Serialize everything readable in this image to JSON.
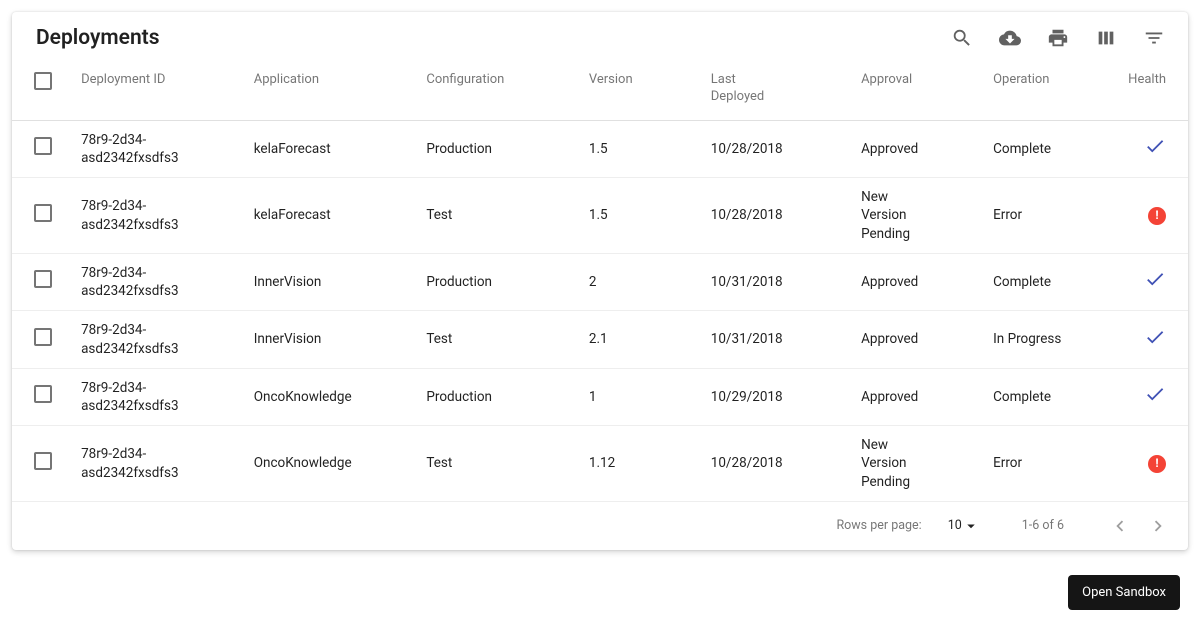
{
  "title": "Deployments",
  "columns": {
    "deployment_id": "Deployment ID",
    "application": "Application",
    "configuration": "Configuration",
    "version": "Version",
    "last_deployed": "Last Deployed",
    "approval": "Approval",
    "operation": "Operation",
    "health": "Health"
  },
  "rows": [
    {
      "deployment_id": "78r9-2d34-asd2342fxsdfs3",
      "application": "kelaForecast",
      "configuration": "Production",
      "version": "1.5",
      "last_deployed": "10/28/2018",
      "approval": "Approved",
      "operation": "Complete",
      "health": "ok"
    },
    {
      "deployment_id": "78r9-2d34-asd2342fxsdfs3",
      "application": "kelaForecast",
      "configuration": "Test",
      "version": "1.5",
      "last_deployed": "10/28/2018",
      "approval": "New Version Pending",
      "operation": "Error",
      "health": "error"
    },
    {
      "deployment_id": "78r9-2d34-asd2342fxsdfs3",
      "application": "InnerVision",
      "configuration": "Production",
      "version": "2",
      "last_deployed": "10/31/2018",
      "approval": "Approved",
      "operation": "Complete",
      "health": "ok"
    },
    {
      "deployment_id": "78r9-2d34-asd2342fxsdfs3",
      "application": "InnerVision",
      "configuration": "Test",
      "version": "2.1",
      "last_deployed": "10/31/2018",
      "approval": "Approved",
      "operation": "In Progress",
      "health": "ok"
    },
    {
      "deployment_id": "78r9-2d34-asd2342fxsdfs3",
      "application": "OncoKnowledge",
      "configuration": "Production",
      "version": "1",
      "last_deployed": "10/29/2018",
      "approval": "Approved",
      "operation": "Complete",
      "health": "ok"
    },
    {
      "deployment_id": "78r9-2d34-asd2342fxsdfs3",
      "application": "OncoKnowledge",
      "configuration": "Test",
      "version": "1.12",
      "last_deployed": "10/28/2018",
      "approval": "New Version Pending",
      "operation": "Error",
      "health": "error"
    }
  ],
  "pagination": {
    "rows_per_page_label": "Rows per page:",
    "rows_per_page_value": "10",
    "range_text": "1-6 of 6"
  },
  "sandbox_button": "Open Sandbox"
}
